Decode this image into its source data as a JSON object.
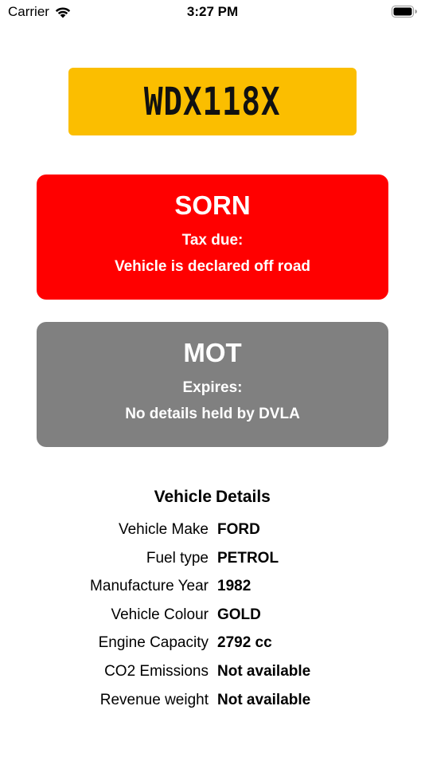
{
  "status_bar": {
    "carrier": "Carrier",
    "time": "3:27 PM"
  },
  "plate": {
    "registration": "WDX118X",
    "color": "#FBBE00"
  },
  "tax": {
    "status": "SORN",
    "label": "Tax due:",
    "detail": "Vehicle is declared off road",
    "color": "#FF0000"
  },
  "mot": {
    "status": "MOT",
    "label": "Expires:",
    "detail": "No details held by DVLA",
    "color": "#808080"
  },
  "details": {
    "title_left": "Vehicle",
    "title_right": "Details",
    "rows": [
      {
        "label": "Vehicle Make",
        "value": "FORD"
      },
      {
        "label": "Fuel type",
        "value": "PETROL"
      },
      {
        "label": "Manufacture Year",
        "value": "1982"
      },
      {
        "label": "Vehicle Colour",
        "value": "GOLD"
      },
      {
        "label": "Engine Capacity",
        "value": "2792 cc"
      },
      {
        "label": "CO2 Emissions",
        "value": "Not available"
      },
      {
        "label": "Revenue weight",
        "value": "Not available"
      }
    ]
  },
  "icons": {
    "wifi": "wifi-icon",
    "battery": "battery-icon"
  }
}
